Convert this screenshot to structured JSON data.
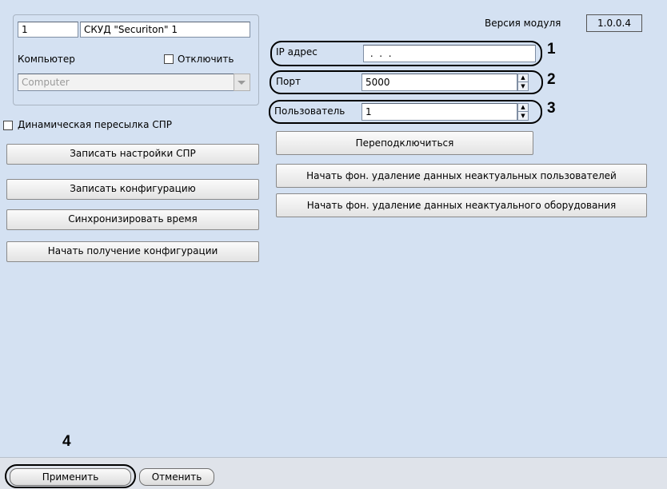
{
  "module_version": {
    "label": "Версия модуля",
    "value": "1.0.0.4"
  },
  "object": {
    "id": "1",
    "name": "СКУД \"Securiton\" 1"
  },
  "computer": {
    "label": "Компьютер",
    "disable_label": "Отключить",
    "value": "Computer"
  },
  "dynamic_forwarding": {
    "label": "Динамическая пересылка СПР",
    "checked": false
  },
  "left_buttons": [
    "Записать настройки СПР",
    "Записать конфигурацию",
    "Синхронизировать время",
    "Начать получение конфигурации"
  ],
  "connection": {
    "ip_label": "IP адрес",
    "ip_value": " .  .  . ",
    "port_label": "Порт",
    "port_value": "5000",
    "user_label": "Пользователь",
    "user_value": "1"
  },
  "right_buttons": {
    "reconnect": "Переподключиться",
    "delete_users": "Начать фон. удаление данных неактуальных пользователей",
    "delete_equipment": "Начать фон. удаление данных неактуального оборудования"
  },
  "callouts": [
    "1",
    "2",
    "3",
    "4"
  ],
  "footer": {
    "apply": "Применить",
    "cancel": "Отменить"
  },
  "colors": {
    "panel": "#d4e1f2",
    "footer": "#dfe3ea"
  }
}
